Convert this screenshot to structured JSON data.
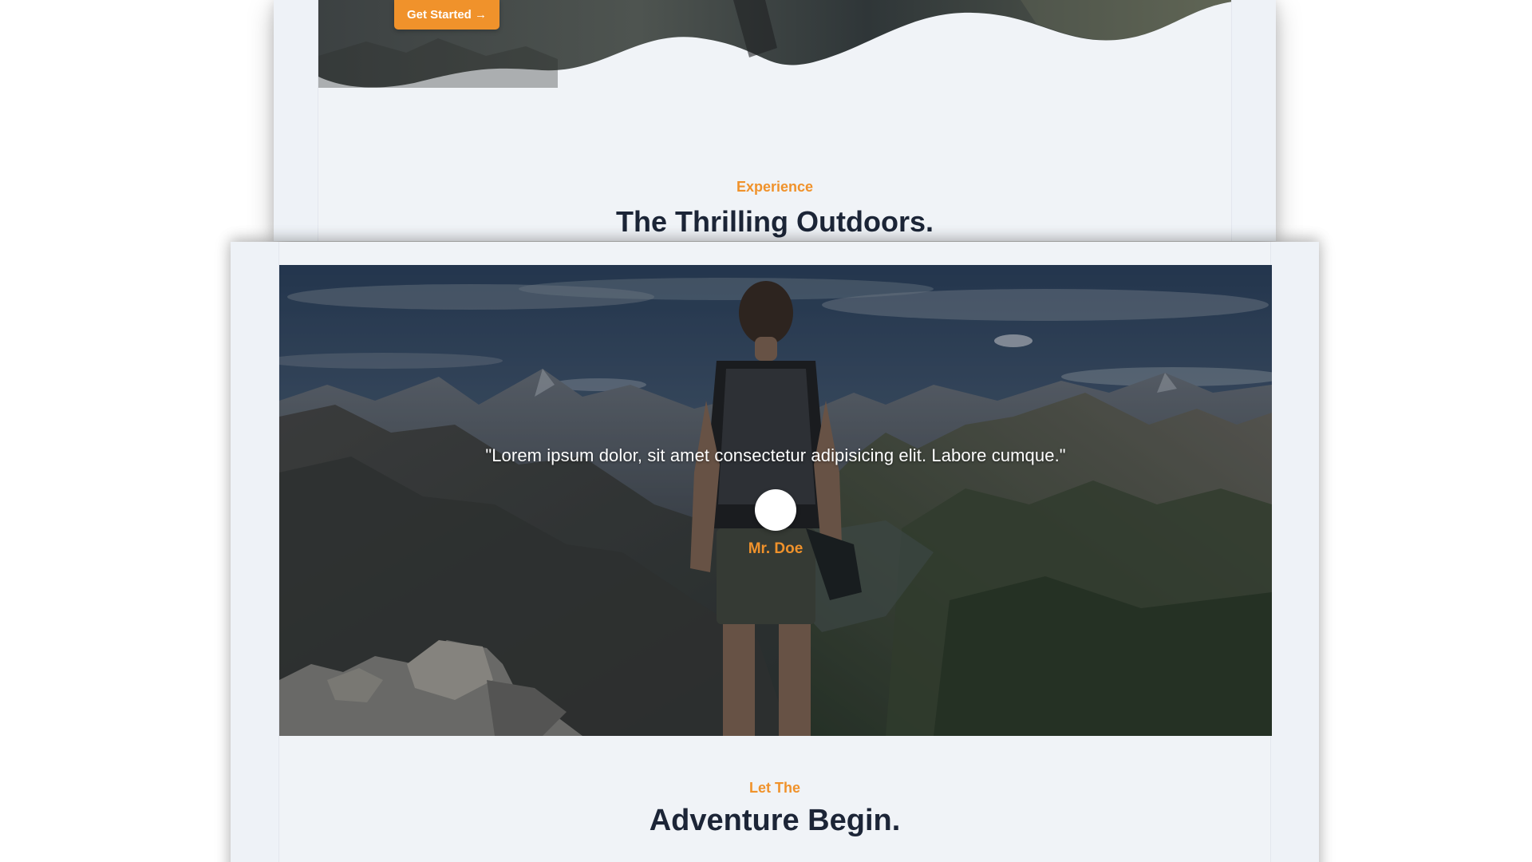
{
  "hero": {
    "cta_label": "Get Started →"
  },
  "section_experience": {
    "eyebrow": "Experience",
    "title": "The Thrilling Outdoors."
  },
  "testimonial": {
    "quote": "\"Lorem ipsum dolor, sit amet consectetur adipisicing elit. Labore cumque.\"",
    "author": "Mr. Doe",
    "image": "hiker-mountain-photo"
  },
  "section_adventure": {
    "eyebrow": "Let The",
    "title": "Adventure Begin."
  },
  "colors": {
    "accent": "#f0922b",
    "heading": "#1c2537",
    "page_bg": "#f0f3f7"
  }
}
